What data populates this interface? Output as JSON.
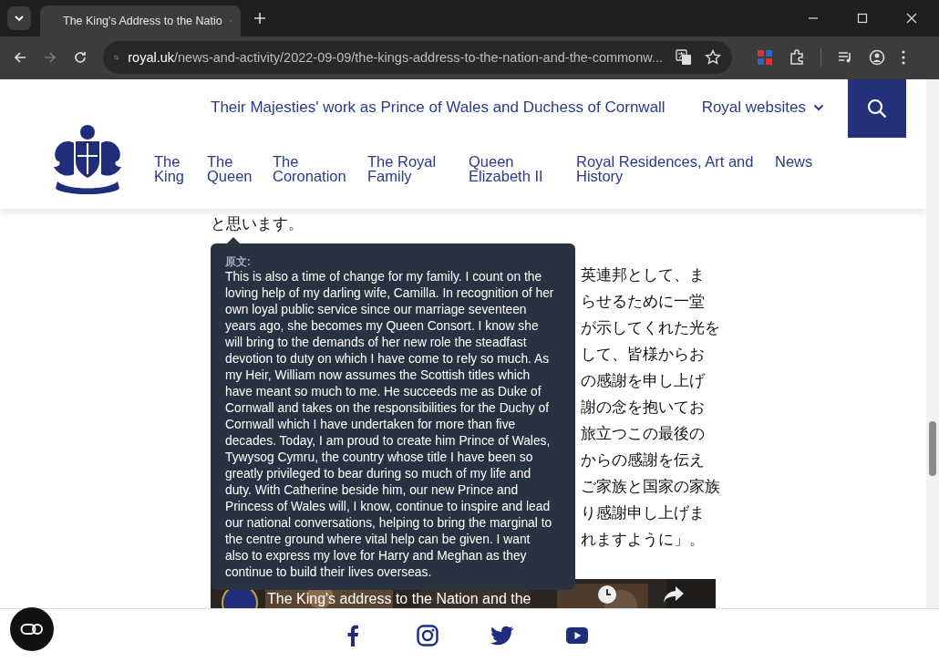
{
  "browser": {
    "tab": {
      "title": "The King's Address to the Natio",
      "selected": true
    },
    "address": {
      "domain": "royal.uk",
      "path": "/news-and-activity/2022-09-09/the-kings-address-to-the-nation-and-the-commonw..."
    }
  },
  "header": {
    "utility_link": "Their Majesties' work as Prince of Wales and Duchess of Cornwall",
    "royal_websites": "Royal websites",
    "nav": [
      {
        "label": "The King"
      },
      {
        "label": "The Queen"
      },
      {
        "label": "The Coronation"
      },
      {
        "label": "The Royal Family"
      },
      {
        "label": "Queen Elizabeth II"
      },
      {
        "label": "Royal Residences, Art and History"
      },
      {
        "label": "News"
      }
    ]
  },
  "article": {
    "paragraph_lines": [
      "と思います。"
    ],
    "partial_lines": [
      "英連邦として、ま",
      "らせるために一堂",
      "が示してくれた光を",
      "して、皆様からお",
      "の感謝を申し上げ",
      "謝の念を抱いてお",
      "旅立つこの最後の",
      "からの感謝を伝え",
      "ご家族と国家の家族",
      "り感謝申し上げま",
      "れますように」。"
    ],
    "video": {
      "title": "The King's address to the Nation and the"
    }
  },
  "tooltip": {
    "label": "原文:",
    "text": "This is also a time of change for my family. I count on the loving help of my darling wife, Camilla. In recognition of her own loyal public service since our marriage seventeen years ago, she becomes my Queen Consort. I know she will bring to the demands of her new role the steadfast devotion to duty on which I have come to rely so much. As my Heir, William now assumes the Scottish titles which have meant so much to me. He succeeds me as Duke of Cornwall and takes on the responsibilities for the Duchy of Cornwall which I have undertaken for more than five decades. Today, I am proud to create him Prince of Wales, Tywysog Cymru, the country whose title I have been so greatly privileged to bear during so much of my life and duty. With Catherine beside him, our new Prince and Princess of Wales will, I know, continue to inspire and lead our national conversations, helping to bring the marginal to the centre ground where vital help can be given. I want also to express my love for Harry and Meghan as they continue to build their lives overseas."
  },
  "footer": {
    "social": [
      {
        "kind": "facebook"
      },
      {
        "kind": "instagram"
      },
      {
        "kind": "twitter"
      },
      {
        "kind": "youtube"
      }
    ]
  }
}
